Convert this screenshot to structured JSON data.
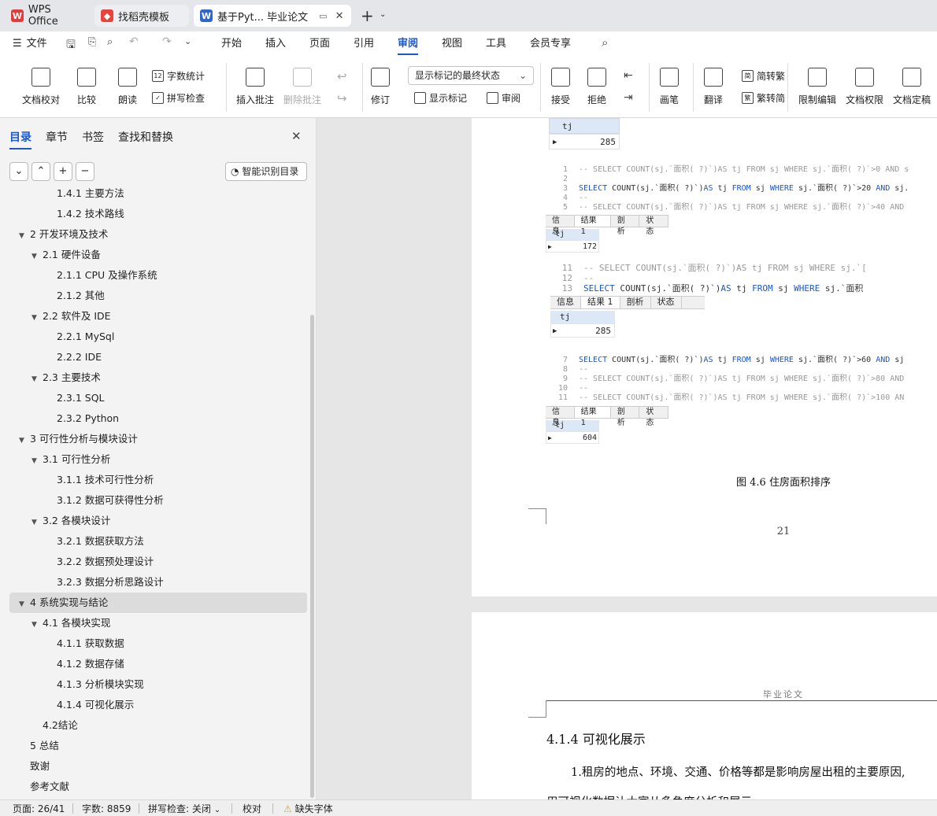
{
  "tabs": [
    {
      "label": "WPS Office"
    },
    {
      "label": "找稻壳模板"
    },
    {
      "label": "基于Pyt... 毕业论文"
    }
  ],
  "menu": {
    "file": "文件",
    "items": [
      "开始",
      "插入",
      "页面",
      "引用",
      "审阅",
      "视图",
      "工具",
      "会员专享"
    ]
  },
  "ribbon": {
    "doc_check": "文档校对",
    "compare": "比较",
    "read_aloud": "朗读",
    "word_count": "字数统计",
    "spell_check": "拼写检查",
    "insert_comment": "插入批注",
    "delete_comment": "删除批注",
    "revise": "修订",
    "markup_state": "显示标记的最终状态",
    "show_markup": "显示标记",
    "review": "审阅",
    "accept": "接受",
    "reject": "拒绝",
    "pen": "画笔",
    "translate": "翻译",
    "to_traditional": "简转繁",
    "to_simplified": "繁转简",
    "restrict_edit": "限制编辑",
    "doc_permission": "文档权限",
    "doc_finalize": "文档定稿"
  },
  "sidebar": {
    "tabs": [
      "目录",
      "章节",
      "书签",
      "查找和替换"
    ],
    "smart_toc": "智能识别目录",
    "toc": [
      {
        "label": "1.4.1 主要方法",
        "level": 3,
        "arrow": ""
      },
      {
        "label": "1.4.2 技术路线",
        "level": 3,
        "arrow": ""
      },
      {
        "label": "2 开发环境及技术",
        "level": 1,
        "arrow": "▼"
      },
      {
        "label": "2.1 硬件设备",
        "level": 2,
        "arrow": "▼"
      },
      {
        "label": "2.1.1 CPU 及操作系统",
        "level": 3,
        "arrow": ""
      },
      {
        "label": "2.1.2  其他",
        "level": 3,
        "arrow": ""
      },
      {
        "label": "2.2 软件及 IDE",
        "level": 2,
        "arrow": "▼"
      },
      {
        "label": "2.2.1 MySql",
        "level": 3,
        "arrow": ""
      },
      {
        "label": "2.2.2 IDE",
        "level": 3,
        "arrow": ""
      },
      {
        "label": "2.3 主要技术",
        "level": 2,
        "arrow": "▼"
      },
      {
        "label": "2.3.1 SQL",
        "level": 3,
        "arrow": ""
      },
      {
        "label": "2.3.2 Python",
        "level": 3,
        "arrow": ""
      },
      {
        "label": "3  可行性分析与模块设计",
        "level": 1,
        "arrow": "▼"
      },
      {
        "label": "3.1  可行性分析",
        "level": 2,
        "arrow": "▼"
      },
      {
        "label": "3.1.1  技术可行性分析",
        "level": 3,
        "arrow": ""
      },
      {
        "label": "3.1.2  数据可获得性分析",
        "level": 3,
        "arrow": ""
      },
      {
        "label": "3.2  各模块设计",
        "level": 2,
        "arrow": "▼"
      },
      {
        "label": "3.2.1  数据获取方法",
        "level": 3,
        "arrow": ""
      },
      {
        "label": "3.2.2  数据预处理设计",
        "level": 3,
        "arrow": ""
      },
      {
        "label": "3.2.3  数据分析思路设计",
        "level": 3,
        "arrow": ""
      },
      {
        "label": "4  系统实现与结论",
        "level": 1,
        "arrow": "▼",
        "highlight": true
      },
      {
        "label": "4.1  各模块实现",
        "level": 2,
        "arrow": "▼"
      },
      {
        "label": "4.1.1  获取数据",
        "level": 3,
        "arrow": ""
      },
      {
        "label": "4.1.2  数据存储",
        "level": 3,
        "arrow": ""
      },
      {
        "label": "4.1.3  分析模块实现",
        "level": 3,
        "arrow": ""
      },
      {
        "label": "4.1.4  可视化展示",
        "level": 3,
        "arrow": ""
      },
      {
        "label": "4.2结论",
        "level": 2,
        "arrow": ""
      },
      {
        "label": "5 总结",
        "level": 1,
        "arrow": ""
      },
      {
        "label": "致谢",
        "level": 1,
        "arrow": ""
      },
      {
        "label": "参考文献",
        "level": 1,
        "arrow": ""
      }
    ]
  },
  "doc": {
    "r0": {
      "col": "tj",
      "val": "285"
    },
    "b1": {
      "lines": [
        {
          "n": "1",
          "t": "-- SELECT COUNT(sj.`面积( ?)`)AS tj FROM sj WHERE sj.`面积( ?)`>0 AND s",
          "c": true
        },
        {
          "n": "2",
          "t": "",
          "c": false
        },
        {
          "n": "3",
          "t": "SELECT COUNT(sj.`面积( ?)`)AS tj FROM sj WHERE sj.`面积( ?)`>20 AND sj.",
          "c": false
        },
        {
          "n": "4",
          "t": "--",
          "c": true
        },
        {
          "n": "5",
          "t": "-- SELECT COUNT(sj.`面积( ?)`)AS tj FROM sj WHERE sj.`面积( ?)`>40 AND",
          "c": true
        }
      ],
      "col": "tj",
      "val": "172"
    },
    "b2": {
      "lines": [
        {
          "n": "11",
          "t": "-- SELECT COUNT(sj.`面积( ?)`)AS tj FROM sj WHERE sj.`[",
          "c": true
        },
        {
          "n": "12",
          "t": "--",
          "c": true
        },
        {
          "n": "13",
          "t": "SELECT COUNT(sj.`面积( ?)`)AS tj FROM sj WHERE sj.`面积",
          "c": false
        }
      ],
      "col": "tj",
      "val": "285"
    },
    "b3": {
      "lines": [
        {
          "n": "7",
          "t": "SELECT COUNT(sj.`面积( ?)`)AS tj FROM sj WHERE sj.`面积( ?)`>60 AND sj",
          "c": false
        },
        {
          "n": "8",
          "t": "--",
          "c": true
        },
        {
          "n": "9",
          "t": "-- SELECT COUNT(sj.`面积( ?)`)AS tj FROM sj WHERE sj.`面积( ?)`>80 AND",
          "c": true
        },
        {
          "n": "10",
          "t": "--",
          "c": true
        },
        {
          "n": "11",
          "t": "-- SELECT COUNT(sj.`面积( ?)`)AS tj FROM sj WHERE sj.`面积( ?)`>100 AN",
          "c": true
        }
      ],
      "col": "tj",
      "val": "604"
    },
    "result_tabs": [
      "信息",
      "结果 1",
      "剖析",
      "状态"
    ],
    "caption": "图 4.6 住房面积排序",
    "page_number": "21",
    "header_text": "毕业论文",
    "heading": "4.1.4  可视化展示",
    "body": "1.租房的地点、环境、交通、价格等都是影响房屋出租的主要原因,",
    "body2": "用可视化数据让大家从多角度分析和展示"
  },
  "status": {
    "page": "页面: 26/41",
    "words": "字数: 8859",
    "spell": "拼写检查: 关闭",
    "proof": "校对",
    "missing_font": "缺失字体"
  }
}
